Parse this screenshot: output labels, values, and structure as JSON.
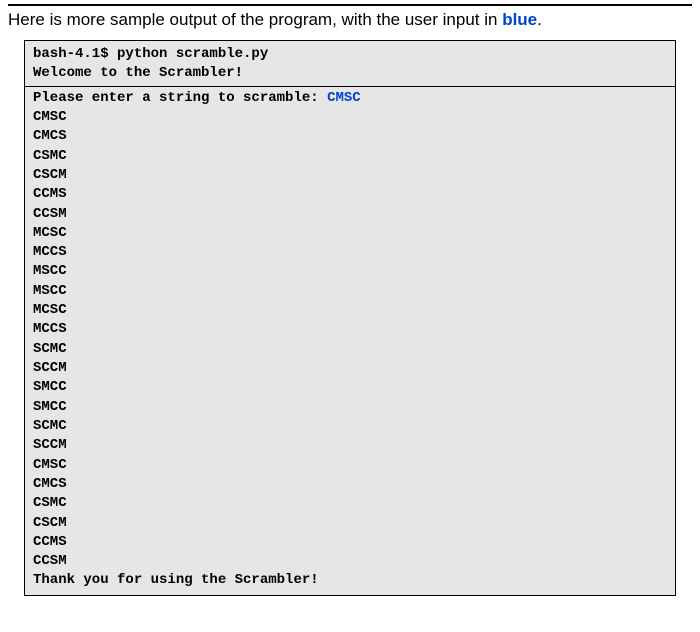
{
  "intro": {
    "prefix": "Here is more sample output of the program, with the user input in ",
    "highlight": "blue",
    "suffix": "."
  },
  "terminal": {
    "cmd": "bash-4.1$ python scramble.py",
    "welcome": "Welcome to the Scrambler!",
    "prompt": "Please enter a string to scramble: ",
    "user_input": "CMSC",
    "outputs": [
      "CMSC",
      "CMCS",
      "CSMC",
      "CSCM",
      "CCMS",
      "CCSM",
      "MCSC",
      "MCCS",
      "MSCC",
      "MSCC",
      "MCSC",
      "MCCS",
      "SCMC",
      "SCCM",
      "SMCC",
      "SMCC",
      "SCMC",
      "SCCM",
      "CMSC",
      "CMCS",
      "CSMC",
      "CSCM",
      "CCMS",
      "CCSM"
    ],
    "thanks": "Thank you for using the Scrambler!"
  }
}
